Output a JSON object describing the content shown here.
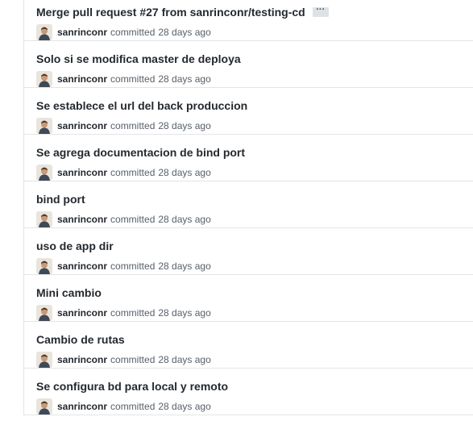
{
  "commits": [
    {
      "title": "Merge pull request #27 from sanrinconr/testing-cd",
      "author": "sanrinconr",
      "action": "committed",
      "time": "28 days ago",
      "has_ellipsis": true,
      "ellipsis": "···"
    },
    {
      "title": "Solo si se modifica master de deploya",
      "author": "sanrinconr",
      "action": "committed",
      "time": "28 days ago"
    },
    {
      "title": "Se establece el url del back produccion",
      "author": "sanrinconr",
      "action": "committed",
      "time": "28 days ago"
    },
    {
      "title": "Se agrega documentacion de bind port",
      "author": "sanrinconr",
      "action": "committed",
      "time": "28 days ago"
    },
    {
      "title": "bind port",
      "author": "sanrinconr",
      "action": "committed",
      "time": "28 days ago"
    },
    {
      "title": "uso de app dir",
      "author": "sanrinconr",
      "action": "committed",
      "time": "28 days ago"
    },
    {
      "title": "Mini cambio",
      "author": "sanrinconr",
      "action": "committed",
      "time": "28 days ago"
    },
    {
      "title": "Cambio de rutas",
      "author": "sanrinconr",
      "action": "committed",
      "time": "28 days ago"
    },
    {
      "title": "Se configura bd para local y remoto",
      "author": "sanrinconr",
      "action": "committed",
      "time": "28 days ago"
    }
  ],
  "colors": {
    "title": "#24292e",
    "meta": "#586069",
    "border": "#e1e4e8",
    "ellipsis_bg": "#dfe2e5"
  }
}
